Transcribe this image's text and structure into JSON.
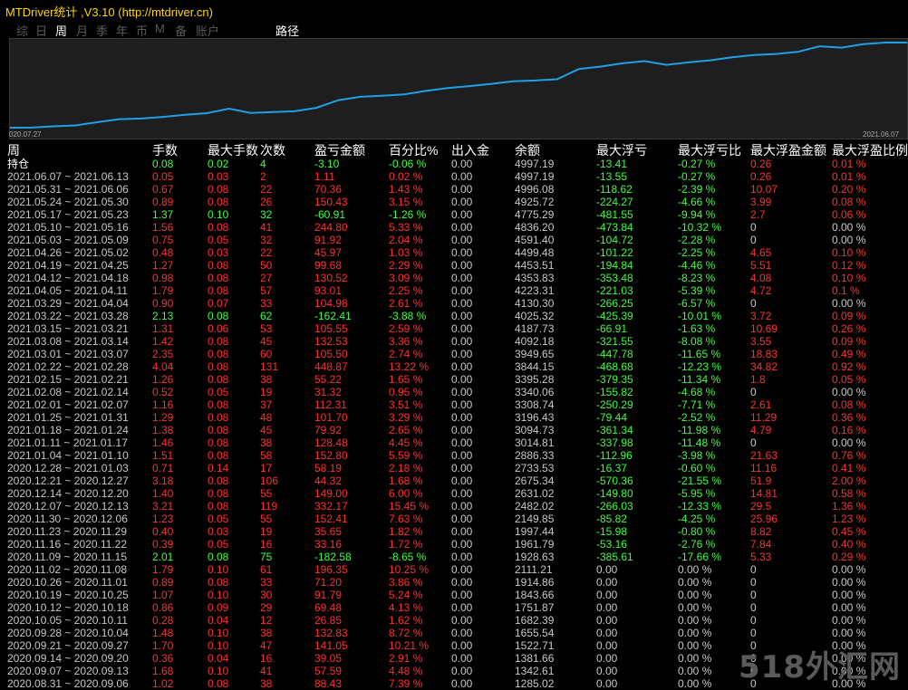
{
  "window": {
    "title": "MTDriver统计 ,V3.10 (http://mtdriver.cn)"
  },
  "tabs": [
    {
      "label": "综",
      "active": false
    },
    {
      "label": "日",
      "active": false
    },
    {
      "label": "周",
      "active": true
    },
    {
      "label": "月",
      "active": false
    },
    {
      "label": "季",
      "active": false
    },
    {
      "label": "年",
      "active": false
    },
    {
      "label": "币",
      "active": false
    },
    {
      "label": "M",
      "active": false
    },
    {
      "label": "备",
      "active": false
    },
    {
      "label": "账户",
      "active": false
    }
  ],
  "path_tab": "路径",
  "chart": {
    "x_start": "020.07.27",
    "x_end": "2021.06.07",
    "line_color": "#1ea0e6",
    "series": [
      1282.99,
      1285.02,
      1342.61,
      1381.66,
      1522.71,
      1655.54,
      1682.39,
      1751.87,
      1843.66,
      1914.86,
      2111.21,
      1928.63,
      1961.79,
      1997.44,
      2149.85,
      2482.02,
      2631.02,
      2675.34,
      2733.53,
      2886.33,
      3014.81,
      3094.73,
      3196.43,
      3308.74,
      3340.06,
      3395.28,
      3844.15,
      3949.65,
      4092.18,
      4187.73,
      4025.32,
      4130.3,
      4223.31,
      4353.83,
      4453.51,
      4499.48,
      4591.4,
      4836.2,
      4775.29,
      4925.72,
      4996.08,
      4997.19
    ]
  },
  "headers": [
    "周",
    "手数",
    "最大手数",
    "次数",
    "盈亏金额",
    "百分比%",
    "出入金",
    "余额",
    "最大浮亏",
    "最大浮亏比",
    "最大浮盈金额",
    "最大浮盈比例"
  ],
  "rows": [
    {
      "c": [
        "持仓",
        "0.08",
        "0.02",
        "4",
        "-3.10",
        "-0.06 %",
        "0.00",
        "4997.19",
        "-13.41",
        "-0.27 %",
        "0.26",
        "0.01 %"
      ],
      "s": "n",
      "m": "p"
    },
    {
      "c": [
        "2021.06.07 ~ 2021.06.13",
        "0.05",
        "0.03",
        "2",
        "1.11",
        "0.02 %",
        "0.00",
        "4997.19",
        "-13.55",
        "-0.27 %",
        "0.26",
        "0.01 %"
      ],
      "s": "p",
      "m": "p"
    },
    {
      "c": [
        "2021.05.31 ~ 2021.06.06",
        "0.67",
        "0.08",
        "22",
        "70.36",
        "1.43 %",
        "0.00",
        "4996.08",
        "-118.62",
        "-2.39 %",
        "10.07",
        "0.20 %"
      ],
      "s": "p",
      "m": "p"
    },
    {
      "c": [
        "2021.05.24 ~ 2021.05.30",
        "0.89",
        "0.08",
        "26",
        "150.43",
        "3.15 %",
        "0.00",
        "4925.72",
        "-224.27",
        "-4.66 %",
        "3.99",
        "0.08 %"
      ],
      "s": "p",
      "m": "p"
    },
    {
      "c": [
        "2021.05.17 ~ 2021.05.23",
        "1.37",
        "0.10",
        "32",
        "-60.91",
        "-1.26 %",
        "0.00",
        "4775.29",
        "-481.55",
        "-9.94 %",
        "2.7",
        "0.06 %"
      ],
      "s": "n",
      "m": "p"
    },
    {
      "c": [
        "2021.05.10 ~ 2021.05.16",
        "1.56",
        "0.08",
        "41",
        "244.80",
        "5.33 %",
        "0.00",
        "4836.20",
        "-473.84",
        "-10.32 %",
        "0",
        "0.00 %"
      ],
      "s": "p",
      "m": "z"
    },
    {
      "c": [
        "2021.05.03 ~ 2021.05.09",
        "0.75",
        "0.05",
        "32",
        "91.92",
        "2.04 %",
        "0.00",
        "4591.40",
        "-104.72",
        "-2.28 %",
        "0",
        "0.00 %"
      ],
      "s": "p",
      "m": "z"
    },
    {
      "c": [
        "2021.04.26 ~ 2021.05.02",
        "0.48",
        "0.03",
        "22",
        "45.97",
        "1.03 %",
        "0.00",
        "4499.48",
        "-101.22",
        "-2.25 %",
        "4.65",
        "0.10 %"
      ],
      "s": "p",
      "m": "p"
    },
    {
      "c": [
        "2021.04.19 ~ 2021.04.25",
        "1.27",
        "0.08",
        "50",
        "99.68",
        "2.29 %",
        "0.00",
        "4453.51",
        "-194.84",
        "-4.46 %",
        "5.51",
        "0.12 %"
      ],
      "s": "p",
      "m": "p"
    },
    {
      "c": [
        "2021.04.12 ~ 2021.04.18",
        "0.98",
        "0.08",
        "27",
        "130.52",
        "3.09 %",
        "0.00",
        "4353.83",
        "-353.48",
        "-8.23 %",
        "4.08",
        "0.10 %"
      ],
      "s": "p",
      "m": "p"
    },
    {
      "c": [
        "2021.04.05 ~ 2021.04.11",
        "1.79",
        "0.08",
        "57",
        "93.01",
        "2.25 %",
        "0.00",
        "4223.31",
        "-221.03",
        "-5.39 %",
        "4.72",
        "0.1 %"
      ],
      "s": "p",
      "m": "p"
    },
    {
      "c": [
        "2021.03.29 ~ 2021.04.04",
        "0.90",
        "0.07",
        "33",
        "104.98",
        "2.61 %",
        "0.00",
        "4130.30",
        "-266.25",
        "-6.57 %",
        "0",
        "0.00 %"
      ],
      "s": "p",
      "m": "z"
    },
    {
      "c": [
        "2021.03.22 ~ 2021.03.28",
        "2.13",
        "0.08",
        "62",
        "-162.41",
        "-3.88 %",
        "0.00",
        "4025.32",
        "-425.39",
        "-10.01 %",
        "3.72",
        "0.09 %"
      ],
      "s": "n",
      "m": "p"
    },
    {
      "c": [
        "2021.03.15 ~ 2021.03.21",
        "1.31",
        "0.06",
        "53",
        "105.55",
        "2.59 %",
        "0.00",
        "4187.73",
        "-66.91",
        "-1.63 %",
        "10.69",
        "0.26 %"
      ],
      "s": "p",
      "m": "p"
    },
    {
      "c": [
        "2021.03.08 ~ 2021.03.14",
        "1.42",
        "0.08",
        "45",
        "132.53",
        "3.36 %",
        "0.00",
        "4092.18",
        "-321.55",
        "-8.08 %",
        "3.55",
        "0.09 %"
      ],
      "s": "p",
      "m": "p"
    },
    {
      "c": [
        "2021.03.01 ~ 2021.03.07",
        "2.35",
        "0.08",
        "60",
        "105.50",
        "2.74 %",
        "0.00",
        "3949.65",
        "-447.78",
        "-11.65 %",
        "18.83",
        "0.49 %"
      ],
      "s": "p",
      "m": "p"
    },
    {
      "c": [
        "2021.02.22 ~ 2021.02.28",
        "4.04",
        "0.08",
        "131",
        "448.87",
        "13.22 %",
        "0.00",
        "3844.15",
        "-468.68",
        "-12.23 %",
        "34.82",
        "0.92 %"
      ],
      "s": "p",
      "m": "p"
    },
    {
      "c": [
        "2021.02.15 ~ 2021.02.21",
        "1.26",
        "0.08",
        "38",
        "55.22",
        "1.65 %",
        "0.00",
        "3395.28",
        "-379.35",
        "-11.34 %",
        "1.8",
        "0.05 %"
      ],
      "s": "p",
      "m": "p"
    },
    {
      "c": [
        "2021.02.08 ~ 2021.02.14",
        "0.52",
        "0.05",
        "19",
        "31.32",
        "0.95 %",
        "0.00",
        "3340.06",
        "-155.82",
        "-4.68 %",
        "0",
        "0.00 %"
      ],
      "s": "p",
      "m": "z"
    },
    {
      "c": [
        "2021.02.01 ~ 2021.02.07",
        "1.16",
        "0.08",
        "37",
        "112.31",
        "3.51 %",
        "0.00",
        "3308.74",
        "-250.29",
        "-7.71 %",
        "2.61",
        "0.08 %"
      ],
      "s": "p",
      "m": "p"
    },
    {
      "c": [
        "2021.01.25 ~ 2021.01.31",
        "1.29",
        "0.08",
        "48",
        "101.70",
        "3.29 %",
        "0.00",
        "3196.43",
        "-79.44",
        "-2.52 %",
        "11.29",
        "0.36 %"
      ],
      "s": "p",
      "m": "p"
    },
    {
      "c": [
        "2021.01.18 ~ 2021.01.24",
        "1.38",
        "0.08",
        "45",
        "79.92",
        "2.65 %",
        "0.00",
        "3094.73",
        "-361.34",
        "-11.98 %",
        "4.79",
        "0.16 %"
      ],
      "s": "p",
      "m": "p"
    },
    {
      "c": [
        "2021.01.11 ~ 2021.01.17",
        "1.46",
        "0.08",
        "38",
        "128.48",
        "4.45 %",
        "0.00",
        "3014.81",
        "-337.98",
        "-11.48 %",
        "0",
        "0.00 %"
      ],
      "s": "p",
      "m": "z"
    },
    {
      "c": [
        "2021.01.04 ~ 2021.01.10",
        "1.51",
        "0.08",
        "58",
        "152.80",
        "5.59 %",
        "0.00",
        "2886.33",
        "-112.96",
        "-3.98 %",
        "21.63",
        "0.76 %"
      ],
      "s": "p",
      "m": "p"
    },
    {
      "c": [
        "2020.12.28 ~ 2021.01.03",
        "0.71",
        "0.14",
        "17",
        "58.19",
        "2.18 %",
        "0.00",
        "2733.53",
        "-16.37",
        "-0.60 %",
        "11.16",
        "0.41 %"
      ],
      "s": "p",
      "m": "p"
    },
    {
      "c": [
        "2020.12.21 ~ 2020.12.27",
        "3.18",
        "0.08",
        "106",
        "44.32",
        "1.68 %",
        "0.00",
        "2675.34",
        "-570.36",
        "-21.55 %",
        "51.9",
        "2.00 %"
      ],
      "s": "p",
      "m": "p"
    },
    {
      "c": [
        "2020.12.14 ~ 2020.12.20",
        "1.40",
        "0.08",
        "55",
        "149.00",
        "6.00 %",
        "0.00",
        "2631.02",
        "-149.80",
        "-5.95 %",
        "14.81",
        "0.58 %"
      ],
      "s": "p",
      "m": "p"
    },
    {
      "c": [
        "2020.12.07 ~ 2020.12.13",
        "3.21",
        "0.08",
        "119",
        "332.17",
        "15.45 %",
        "0.00",
        "2482.02",
        "-266.03",
        "-12.33 %",
        "29.5",
        "1.36 %"
      ],
      "s": "p",
      "m": "p"
    },
    {
      "c": [
        "2020.11.30 ~ 2020.12.06",
        "1.23",
        "0.05",
        "55",
        "152.41",
        "7.63 %",
        "0.00",
        "2149.85",
        "-85.82",
        "-4.25 %",
        "25.96",
        "1.23 %"
      ],
      "s": "p",
      "m": "p"
    },
    {
      "c": [
        "2020.11.23 ~ 2020.11.29",
        "0.40",
        "0.03",
        "19",
        "35.65",
        "1.82 %",
        "0.00",
        "1997.44",
        "-15.98",
        "-0.80 %",
        "8.82",
        "0.45 %"
      ],
      "s": "p",
      "m": "p"
    },
    {
      "c": [
        "2020.11.16 ~ 2020.11.22",
        "0.39",
        "0.05",
        "16",
        "33.16",
        "1.72 %",
        "0.00",
        "1961.79",
        "-53.16",
        "-2.76 %",
        "7.84",
        "0.40 %"
      ],
      "s": "p",
      "m": "p"
    },
    {
      "c": [
        "2020.11.09 ~ 2020.11.15",
        "2.01",
        "0.08",
        "75",
        "-182.58",
        "-8.65 %",
        "0.00",
        "1928.63",
        "-385.61",
        "-17.66 %",
        "5.33",
        "0.29 %"
      ],
      "s": "n",
      "m": "p"
    },
    {
      "c": [
        "2020.11.02 ~ 2020.11.08",
        "1.79",
        "0.10",
        "61",
        "196.35",
        "10.25 %",
        "0.00",
        "2111.21",
        "0.00",
        "0.00 %",
        "0",
        "0.00 %"
      ],
      "s": "p",
      "m": "z"
    },
    {
      "c": [
        "2020.10.26 ~ 2020.11.01",
        "0.89",
        "0.08",
        "33",
        "71.20",
        "3.86 %",
        "0.00",
        "1914.86",
        "0.00",
        "0.00 %",
        "0",
        "0.00 %"
      ],
      "s": "p",
      "m": "z"
    },
    {
      "c": [
        "2020.10.19 ~ 2020.10.25",
        "1.07",
        "0.10",
        "30",
        "91.79",
        "5.24 %",
        "0.00",
        "1843.66",
        "0.00",
        "0.00 %",
        "0",
        "0.00 %"
      ],
      "s": "p",
      "m": "z"
    },
    {
      "c": [
        "2020.10.12 ~ 2020.10.18",
        "0.86",
        "0.09",
        "29",
        "69.48",
        "4.13 %",
        "0.00",
        "1751.87",
        "0.00",
        "0.00 %",
        "0",
        "0.00 %"
      ],
      "s": "p",
      "m": "z"
    },
    {
      "c": [
        "2020.10.05 ~ 2020.10.11",
        "0.28",
        "0.04",
        "12",
        "26.85",
        "1.62 %",
        "0.00",
        "1682.39",
        "0.00",
        "0.00 %",
        "0",
        "0.00 %"
      ],
      "s": "p",
      "m": "z"
    },
    {
      "c": [
        "2020.09.28 ~ 2020.10.04",
        "1.48",
        "0.10",
        "38",
        "132.83",
        "8.72 %",
        "0.00",
        "1655.54",
        "0.00",
        "0.00 %",
        "0",
        "0.00 %"
      ],
      "s": "p",
      "m": "z"
    },
    {
      "c": [
        "2020.09.21 ~ 2020.09.27",
        "1.70",
        "0.10",
        "47",
        "141.05",
        "10.21 %",
        "0.00",
        "1522.71",
        "0.00",
        "0.00 %",
        "0",
        "0.00 %"
      ],
      "s": "p",
      "m": "z"
    },
    {
      "c": [
        "2020.09.14 ~ 2020.09.20",
        "0.36",
        "0.04",
        "16",
        "39.05",
        "2.91 %",
        "0.00",
        "1381.66",
        "0.00",
        "0.00 %",
        "0",
        "0.00 %"
      ],
      "s": "p",
      "m": "z"
    },
    {
      "c": [
        "2020.09.07 ~ 2020.09.13",
        "1.68",
        "0.10",
        "41",
        "57.59",
        "4.48 %",
        "0.00",
        "1342.61",
        "0.00",
        "0.00 %",
        "0",
        "0.00 %"
      ],
      "s": "p",
      "m": "z"
    },
    {
      "c": [
        "2020.08.31 ~ 2020.09.06",
        "1.02",
        "0.08",
        "38",
        "88.43",
        "7.39 %",
        "0.00",
        "1285.02",
        "0.00",
        "0.00 %",
        "0",
        "0.00 %"
      ],
      "s": "p",
      "m": "z"
    }
  ],
  "watermark": "518外汇网"
}
